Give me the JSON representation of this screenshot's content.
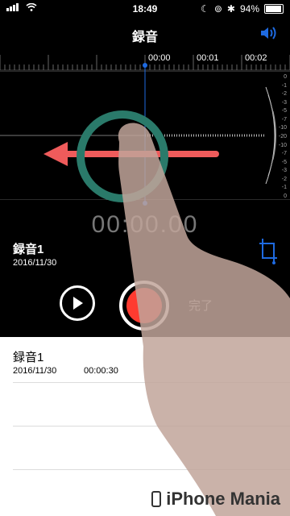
{
  "status_bar": {
    "time": "18:49",
    "battery_percent": "94%",
    "battery_level": 0.94
  },
  "nav": {
    "title": "録音"
  },
  "time_ruler": {
    "labels": [
      "00:00",
      "00:01",
      "00:02"
    ]
  },
  "level_scale": [
    "0",
    "-1",
    "-2",
    "-3",
    "-5",
    "-7",
    "-10",
    "-20",
    "-10",
    "-7",
    "-5",
    "-3",
    "-2",
    "-1",
    "0"
  ],
  "timer": "00:00.00",
  "current_recording": {
    "title": "録音1",
    "date": "2016/11/30"
  },
  "controls": {
    "done_label": "完了"
  },
  "recordings": [
    {
      "title": "録音1",
      "date": "2016/11/30",
      "duration": "00:00:30"
    }
  ],
  "watermark": "iPhone Mania",
  "colors": {
    "record_red": "#ff3b30",
    "playhead_blue": "#1e6ae0",
    "gesture_circle": "#2a7a6a",
    "gesture_arrow": "#ef5b5b"
  }
}
